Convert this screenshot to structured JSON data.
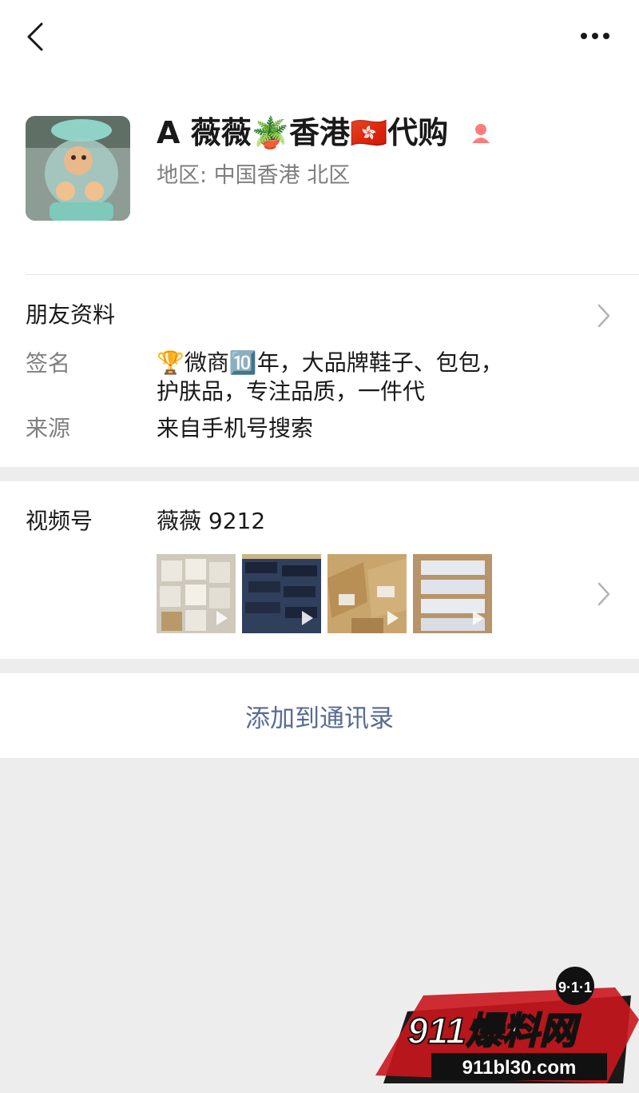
{
  "profile": {
    "name": "A 薇薇🪴香港🇭🇰代购",
    "region": "地区: 中国香港 北区"
  },
  "info": {
    "section_title": "朋友资料",
    "signature_label": "签名",
    "signature_text": "🏆微商🔟年，大品牌鞋子、包包，护肤品，专注品质，一件代",
    "source_label": "来源",
    "source_text": "来自手机号搜索"
  },
  "channels": {
    "label": "视频号",
    "name": "薇薇 9212",
    "thumbnails": [
      "thumbnail-1",
      "thumbnail-2",
      "thumbnail-3",
      "thumbnail-4"
    ]
  },
  "actions": {
    "add_to_contacts": "添加到通讯录"
  },
  "watermark": {
    "badge": "9·1·1",
    "title": "911爆料网",
    "url": "911bl30.com"
  },
  "icons": {
    "back": "chevron-left-icon",
    "more": "more-dots-icon",
    "gender": "female-icon",
    "chevron": "chevron-right-icon"
  },
  "colors": {
    "link": "#576b95",
    "secondary_text": "#7f7f7f",
    "background": "#ededed",
    "female_icon": "#fa5151"
  }
}
